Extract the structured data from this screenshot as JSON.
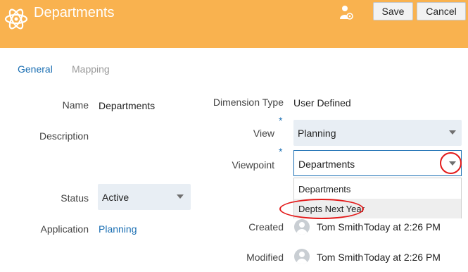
{
  "header": {
    "title": "Departments",
    "save_label": "Save",
    "cancel_label": "Cancel"
  },
  "tabs": [
    {
      "label": "General"
    },
    {
      "label": "Mapping"
    }
  ],
  "form": {
    "name_label": "Name",
    "name_value": "Departments",
    "description_label": "Description",
    "status_label": "Status",
    "status_value": "Active",
    "application_label": "Application",
    "application_value": "Planning",
    "dimension_type_label": "Dimension Type",
    "dimension_type_value": "User Defined",
    "view_label": "View",
    "view_value": "Planning",
    "viewpoint_label": "Viewpoint",
    "viewpoint_value": "Departments",
    "required_marker": "*",
    "created_label": "Created",
    "created_user": "Tom Smith",
    "created_time": "Today at 2:26 PM",
    "modified_label": "Modified",
    "modified_user": "Tom Smith",
    "modified_time": "Today at 2:26 PM"
  },
  "viewpoint_options": [
    {
      "label": "Departments"
    },
    {
      "label": "Depts Next Year"
    }
  ],
  "colors": {
    "header": "#f9b24f",
    "link": "#1b6fb3",
    "annotation": "#e31a1a"
  }
}
